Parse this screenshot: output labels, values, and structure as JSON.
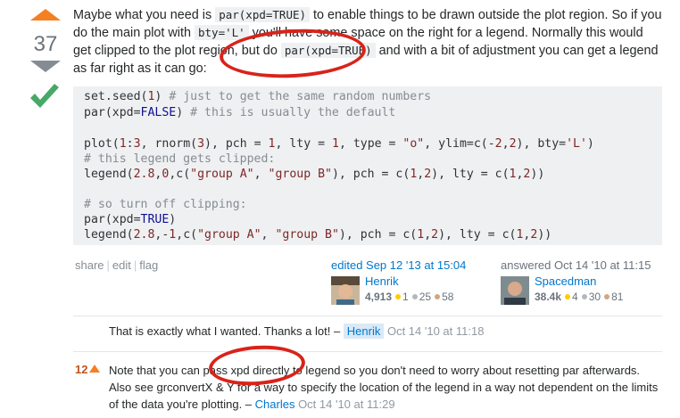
{
  "vote": {
    "count": "37"
  },
  "post": {
    "p1_a": "Maybe what you need is ",
    "p1_code1": "par(xpd=TRUE)",
    "p1_b": " to enable things to be drawn outside the plot region. So if you do the main plot with ",
    "p1_code2": "bty='L'",
    "p1_c": " you'll have some space on the right for a legend. Normally this would get clipped to the plot region, but do ",
    "p1_code3": "par(xpd=TRUE)",
    "p1_d": " and with a bit of adjustment you can get a legend as far right as it can go:"
  },
  "code": {
    "l1a": "set.seed(",
    "l1n": "1",
    "l1b": ") ",
    "l1c": "# just to get the same random numbers",
    "l2a": "par(xpd=",
    "l2k": "FALSE",
    "l2b": ") ",
    "l2c": "# this is usually the default",
    "l3a": "plot(",
    "l3n1": "1",
    "l3b": ":",
    "l3n2": "3",
    "l3c": ", rnorm(",
    "l3n3": "3",
    "l3d": "), pch = ",
    "l3n4": "1",
    "l3e": ", lty = ",
    "l3n5": "1",
    "l3f": ", type = ",
    "l3s1": "\"o\"",
    "l3g": ", ylim=c(-",
    "l3n6": "2",
    "l3h": ",",
    "l3n7": "2",
    "l3i": "), bty=",
    "l3s2": "'L'",
    "l3j": ")",
    "l4c": "# this legend gets clipped:",
    "l5a": "legend(",
    "l5n1": "2.8",
    "l5b": ",",
    "l5n2": "0",
    "l5c": ",c(",
    "l5s1": "\"group A\"",
    "l5d": ", ",
    "l5s2": "\"group B\"",
    "l5e": "), pch = c(",
    "l5n3": "1",
    "l5f": ",",
    "l5n4": "2",
    "l5g": "), lty = c(",
    "l5n5": "1",
    "l5h": ",",
    "l5n6": "2",
    "l5i": "))",
    "l6c": "# so turn off clipping:",
    "l7a": "par(xpd=",
    "l7k": "TRUE",
    "l7b": ")",
    "l8a": "legend(",
    "l8n1": "2.8",
    "l8b": ",-",
    "l8n2": "1",
    "l8c": ",c(",
    "l8s1": "\"group A\"",
    "l8d": ", ",
    "l8s2": "\"group B\"",
    "l8e": "), pch = c(",
    "l8n3": "1",
    "l8f": ",",
    "l8n4": "2",
    "l8g": "), lty = c(",
    "l8n5": "1",
    "l8h": ",",
    "l8n6": "2",
    "l8i": "))"
  },
  "menu": {
    "share": "share",
    "edit": "edit",
    "flag": "flag"
  },
  "editor": {
    "action": "edited Sep 12 '13 at 15:04",
    "name": "Henrik",
    "rep": "4,913",
    "gold": "1",
    "silver": "25",
    "bronze": "58"
  },
  "author": {
    "action": "answered Oct 14 '10 at 11:15",
    "name": "Spacedman",
    "rep": "38.4k",
    "gold": "4",
    "silver": "30",
    "bronze": "81"
  },
  "comments": [
    {
      "text": "That is exactly what I wanted. Thanks a lot! – ",
      "user": "Henrik",
      "time": " Oct 14 '10 at 11:18"
    },
    {
      "score": "12",
      "text_a": "Note that you can pass xpd directly to legend so you don't need to worry about resetting par afterwards.",
      "text_b": "Also see grconvertX & Y for a way to specify the location of the legend in a way not dependent on the limits",
      "text_c": "of the data you're plotting. – ",
      "user": "Charles",
      "time": " Oct 14 '10 at 11:29"
    }
  ],
  "colors": {
    "upvote": "#f48024",
    "accepted": "#48a868",
    "link": "#0077cc",
    "annotation": "#d8231a"
  }
}
